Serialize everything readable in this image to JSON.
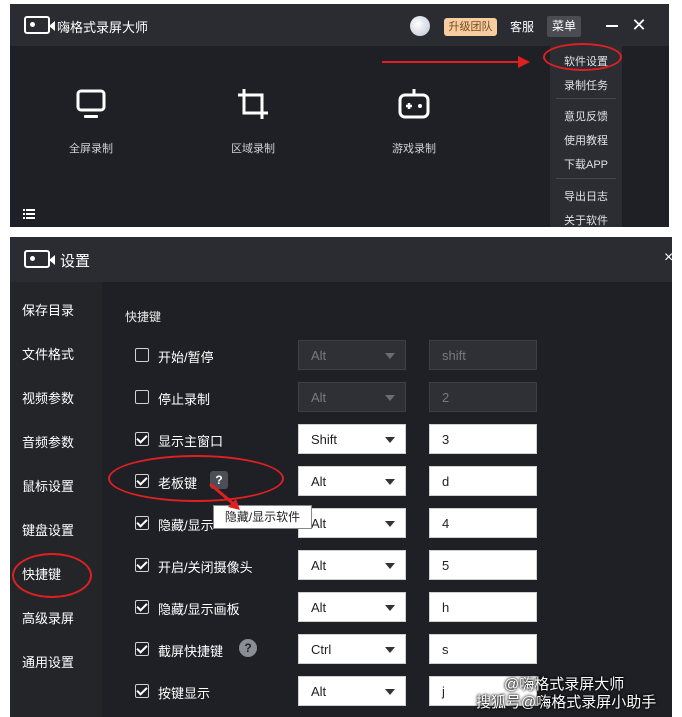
{
  "top_window": {
    "app_title": "嗨格式录屏大师",
    "upgrade_label": "升级团队",
    "service_label": "客服",
    "menu_label": "菜单",
    "tools": [
      {
        "label": "全屏录制",
        "icon": "monitor-icon"
      },
      {
        "label": "区域录制",
        "icon": "crop-icon"
      },
      {
        "label": "游戏录制",
        "icon": "gamepad-icon"
      }
    ],
    "menu_items": [
      "软件设置",
      "录制任务",
      "意见反馈",
      "使用教程",
      "下载APP",
      "导出日志",
      "关于软件"
    ]
  },
  "settings_window": {
    "title": "设置",
    "close_label": "×",
    "nav_items": [
      "保存目录",
      "文件格式",
      "视频参数",
      "音频参数",
      "鼠标设置",
      "键盘设置",
      "快捷键",
      "高级录屏",
      "通用设置"
    ],
    "active_nav": "快捷键",
    "section_title": "快捷键",
    "hotkeys": [
      {
        "label": "开始/暂停",
        "checked": false,
        "modifier": "Alt",
        "key": "shift",
        "disabled": true
      },
      {
        "label": "停止录制",
        "checked": false,
        "modifier": "Alt",
        "key": "2",
        "disabled": true
      },
      {
        "label": "显示主窗口",
        "checked": true,
        "modifier": "Shift",
        "key": "3",
        "disabled": false
      },
      {
        "label": "老板键",
        "checked": true,
        "modifier": "Alt",
        "key": "d",
        "disabled": false,
        "help": "?"
      },
      {
        "label": "隐藏/显示",
        "checked": true,
        "modifier": "Alt",
        "key": "4",
        "disabled": false
      },
      {
        "label": "开启/关闭摄像头",
        "checked": true,
        "modifier": "Alt",
        "key": "5",
        "disabled": false
      },
      {
        "label": "隐藏/显示画板",
        "checked": true,
        "modifier": "Alt",
        "key": "h",
        "disabled": false
      },
      {
        "label": "截屏快捷键",
        "checked": true,
        "modifier": "Ctrl",
        "key": "s",
        "disabled": false,
        "help": "?"
      },
      {
        "label": "按键显示",
        "checked": true,
        "modifier": "Alt",
        "key": "j",
        "disabled": false
      }
    ],
    "tooltip": "隐藏/显示软件"
  },
  "watermark": {
    "line1": "@嗨格式录屏大师",
    "line2": "搜狐号@嗨格式录屏小助手"
  },
  "colors": {
    "window_bg": "#1e2025",
    "titlebar_bg": "#2a2c31",
    "annotation_red": "#e02020",
    "upgrade_bg": "#f5cda0"
  }
}
